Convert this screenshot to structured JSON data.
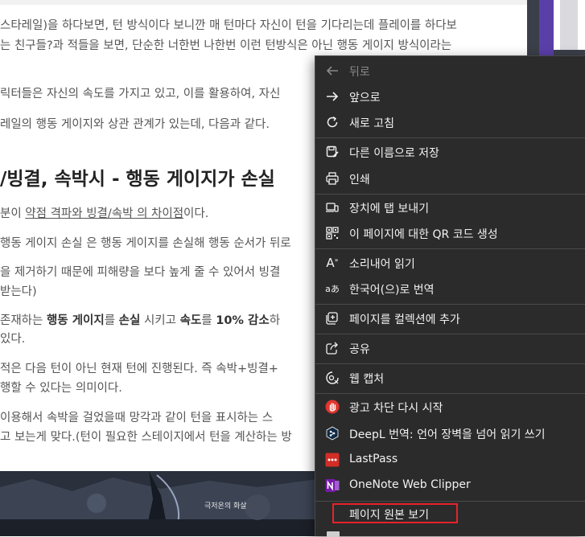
{
  "article": {
    "lines": [
      "스타레일)을 하다보면, 턴 방식이다 보니깐 매 턴마다 자신이 턴을 기다리는데 플레이를 하다보",
      "는 친구들?과 적들을 보면, 단순한 너한번 나한번 이런 턴방식은 아닌 행동 게이지 방식이라는",
      "릭터들은 자신의 속도를 가지고 있고, 이를 활용하여, 자신",
      "레일의 행동 게이지와 상관 관계가 있는데, 다음과 같다."
    ],
    "heading": "/빙결, 속박시 - 행동 게이지가 손실",
    "line5_prefix": "분이 ",
    "line5_link": "약점 격파와 빙결/속박 의 차이점",
    "line5_suffix": "이다.",
    "line6": "행동 게이지 손실 은 행동 게이지를 손실해 행동 순서가 뒤로",
    "line7": "을 제거하기 때문에 피해량을 보다 높게 줄 수 있어서 빙결",
    "line8": "받는다)",
    "line9_a": "존재하는 ",
    "line9_b": "행동 게이지",
    "line9_c": "를 ",
    "line9_d": "손실",
    "line9_e": " 시키고 ",
    "line9_f": "속도",
    "line9_g": "를 ",
    "line9_h": "10% 감소",
    "line9_i": "하",
    "line10": "있다.",
    "line11": "적은 다음 턴이 아닌 현재 턴에 진행된다. 즉 속박+빙결+",
    "line12": "행할 수 있다는 의미이다.",
    "line13": "이용해서 속박을 걸었을때 망각과 같이 턴을 표시하는 스",
    "line14": "고 보는게 맞다.(턴이 필요한 스테이지에서 턴을 계산하는 방",
    "image_caption": "극저온의 화살"
  },
  "menu": {
    "items": [
      {
        "label": "뒤로",
        "icon": "back-arrow-icon",
        "disabled": true
      },
      {
        "label": "앞으로",
        "icon": "forward-arrow-icon"
      },
      {
        "label": "새로 고침",
        "icon": "refresh-icon"
      },
      {
        "label": "다른 이름으로 저장",
        "icon": "save-as-icon"
      },
      {
        "label": "인쇄",
        "icon": "print-icon"
      },
      {
        "label": "장치에 탭 보내기",
        "icon": "send-tab-icon"
      },
      {
        "label": "이 페이지에 대한 QR 코드 생성",
        "icon": "qr-code-icon"
      },
      {
        "label": "소리내어 읽기",
        "icon": "read-aloud-icon"
      },
      {
        "label": "한국어(으)로 번역",
        "icon": "translate-icon"
      },
      {
        "label": "페이지를 컬렉션에 추가",
        "icon": "collections-icon"
      },
      {
        "label": "공유",
        "icon": "share-icon"
      },
      {
        "label": "웹 캡처",
        "icon": "web-capture-icon"
      },
      {
        "label": "광고 차단 다시 시작",
        "icon": "adblock-hand-icon"
      },
      {
        "label": "DeepL 번역: 언어 장벽을 넘어 읽기  쓰기",
        "icon": "deepl-icon"
      },
      {
        "label": "LastPass",
        "icon": "lastpass-icon"
      },
      {
        "label": "OneNote Web Clipper",
        "icon": "onenote-icon"
      },
      {
        "label": "페이지 원본 보기",
        "icon": ""
      }
    ],
    "read_aloud_glyph": "A",
    "translate_glyph": "aあ"
  },
  "colors": {
    "menu_bg": "#2b2b2b",
    "highlight": "#e8222a",
    "adblock": "#e0362f",
    "lastpass": "#d32d27",
    "onenote": "#7719aa",
    "deepl": "#0f2b46"
  }
}
